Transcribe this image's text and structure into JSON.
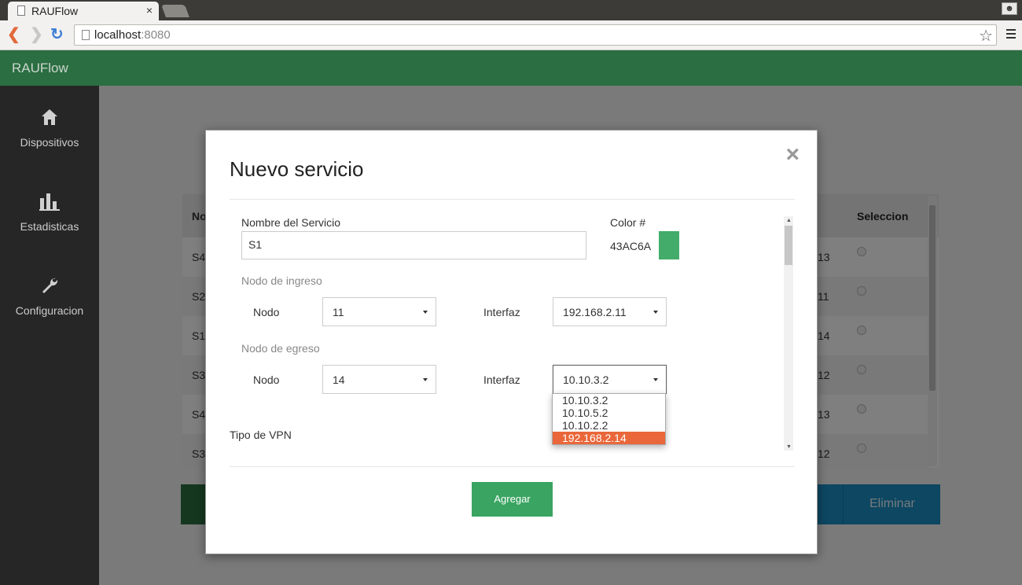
{
  "browser": {
    "tab_title": "RAUFlow",
    "tab_close": "×",
    "url_host": "localhost",
    "url_port": ":8080"
  },
  "app": {
    "brand": "RAUFlow"
  },
  "sidebar": {
    "items": [
      {
        "label": "Dispositivos",
        "icon": "home-icon"
      },
      {
        "label": "Estadisticas",
        "icon": "bar-chart-icon"
      },
      {
        "label": "Configuracion",
        "icon": "wrench-icon"
      }
    ]
  },
  "background_table": {
    "header_left": "No",
    "header_select": "Seleccion",
    "rows": [
      {
        "left": "S4",
        "right": "13"
      },
      {
        "left": "S2",
        "right": "11"
      },
      {
        "left": "S1",
        "right": "14"
      },
      {
        "left": "S3",
        "right": "12"
      },
      {
        "left": "S4",
        "right": "13"
      },
      {
        "left": "S3",
        "right": "12"
      }
    ],
    "delete_button": "Eliminar"
  },
  "modal": {
    "title": "Nuevo servicio",
    "close_glyph": "×",
    "service_name_label": "Nombre del Servicio",
    "service_name_value": "S1",
    "color_label": "Color #",
    "color_value": "43AC6A",
    "color_swatch": "#43AC6A",
    "ingress_section": "Nodo de ingreso",
    "egress_section": "Nodo de egreso",
    "node_label": "Nodo",
    "interface_label": "Interfaz",
    "ingress_node": "11",
    "ingress_interface": "192.168.2.11",
    "egress_node": "14",
    "egress_interface": "10.10.3.2",
    "vpn_type_label": "Tipo de VPN",
    "add_button": "Agregar"
  },
  "dropdown": {
    "options": [
      "10.10.3.2",
      "10.10.5.2",
      "10.10.2.2",
      "192.168.2.14"
    ],
    "highlighted_index": 3
  },
  "colors": {
    "header_green": "#2b6e41",
    "sidebar": "#262626",
    "accent_green": "#3aa462",
    "highlight_orange": "#e9673a",
    "action_blue": "#1a8fc4"
  }
}
